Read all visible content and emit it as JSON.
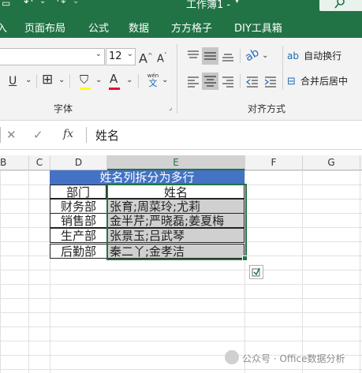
{
  "title_bar": {
    "partial_title": "工作簿1 -"
  },
  "tabs": [
    "页面布局",
    "公式",
    "数据",
    "方方格子",
    "DIY工具箱"
  ],
  "font_group": {
    "font_size": "12",
    "label": "字体",
    "pinyin_label": "wén"
  },
  "align_group": {
    "wrap_text": "自动换行",
    "merge_center": "合并后居中",
    "label": "对齐方式"
  },
  "formula_bar": {
    "fx": "fx",
    "content": "姓名"
  },
  "columns": [
    "B",
    "C",
    "D",
    "E",
    "F",
    "G"
  ],
  "sheet": {
    "title": "姓名列拆分为多行",
    "header_dept": "部门",
    "header_name": "姓名",
    "rows": [
      {
        "dept": "财务部",
        "names": "张育;周菜玲;尤莉"
      },
      {
        "dept": "销售部",
        "names": "金半芹;严晓磊;姜夏梅"
      },
      {
        "dept": "生产部",
        "names": "张景玉;吕武琴"
      },
      {
        "dept": "后勤部",
        "names": "秦二丫;金孝洁"
      }
    ]
  },
  "watermark": "公众号 · Office数据分析",
  "colors": {
    "excel_green": "#217346",
    "title_fill": "#4472c4",
    "selection_fill": "#d0d0d0"
  }
}
